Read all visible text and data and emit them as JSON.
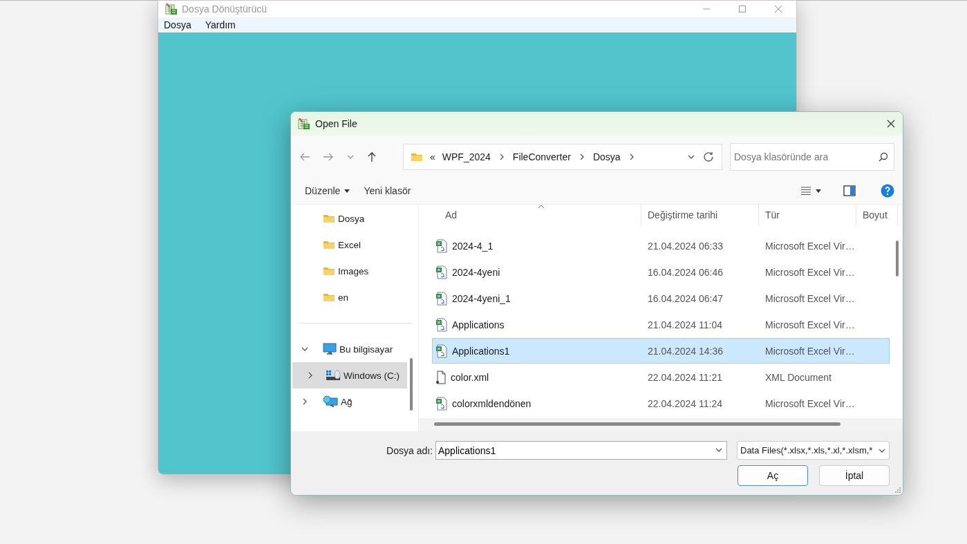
{
  "background_window": {
    "title": "Dosya Dönüştürücü",
    "menu": [
      "Dosya",
      "Yardım"
    ]
  },
  "dialog": {
    "title": "Open File",
    "overflow": "«",
    "breadcrumb": [
      "WPF_2024",
      "FileConverter",
      "Dosya"
    ],
    "search": {
      "placeholder": "Dosya klasöründe ara"
    },
    "toolbar": [
      {
        "label": "Düzenle",
        "kind": "menu"
      },
      {
        "label": "Yeni klasör",
        "kind": "plain"
      }
    ],
    "sidebar": {
      "items": [
        {
          "label": "Dosya",
          "kind": "folder",
          "selected": false
        },
        {
          "label": "Excel",
          "kind": "folder",
          "selected": false
        },
        {
          "label": "Images",
          "kind": "folder",
          "selected": false
        },
        {
          "label": "en",
          "kind": "folder",
          "selected": false
        },
        {
          "kind": "separator"
        },
        {
          "label": "Bu bilgisayar",
          "kind": "computer",
          "expanded": true,
          "selected": false,
          "children": [
            {
              "label": "Windows (C:)",
              "kind": "drive",
              "expanded": false,
              "selected": true
            }
          ]
        },
        {
          "label": "Ağ",
          "kind": "network",
          "expanded": false,
          "selected": false
        }
      ]
    },
    "columns": [
      "Ad",
      "Değiştirme tarihi",
      "Tür",
      "Boyut"
    ],
    "rows": [
      {
        "name": "2024-4_1",
        "date": "21.04.2024 06:33",
        "type": "Microsoft Excel Vir…",
        "kind": "excel",
        "selected": false
      },
      {
        "name": "2024-4yeni",
        "date": "16.04.2024 06:46",
        "type": "Microsoft Excel Vir…",
        "kind": "excel",
        "selected": false
      },
      {
        "name": "2024-4yeni_1",
        "date": "16.04.2024 06:47",
        "type": "Microsoft Excel Vir…",
        "kind": "excel",
        "selected": false
      },
      {
        "name": "Applications",
        "date": "21.04.2024 11:04",
        "type": "Microsoft Excel Vir…",
        "kind": "excel",
        "selected": false
      },
      {
        "name": "Applications1",
        "date": "21.04.2024 14:36",
        "type": "Microsoft Excel Vir…",
        "kind": "excel",
        "selected": true
      },
      {
        "name": "color.xml",
        "date": "22.04.2024 11:21",
        "type": "XML Document",
        "kind": "xml",
        "selected": false
      },
      {
        "name": "colorxmldendönen",
        "date": "22.04.2024 11:24",
        "type": "Microsoft Excel Vir…",
        "kind": "excel",
        "selected": false
      }
    ],
    "file_name": {
      "label": "Dosya adı:",
      "value": "Applications1"
    },
    "file_type": "Data Files(*.xlsx,*.xls,*.xl,*.xlsm,*",
    "buttons": [
      {
        "label": "Aç",
        "kind": "default"
      },
      {
        "label": "İptal",
        "kind": "normal"
      }
    ]
  }
}
